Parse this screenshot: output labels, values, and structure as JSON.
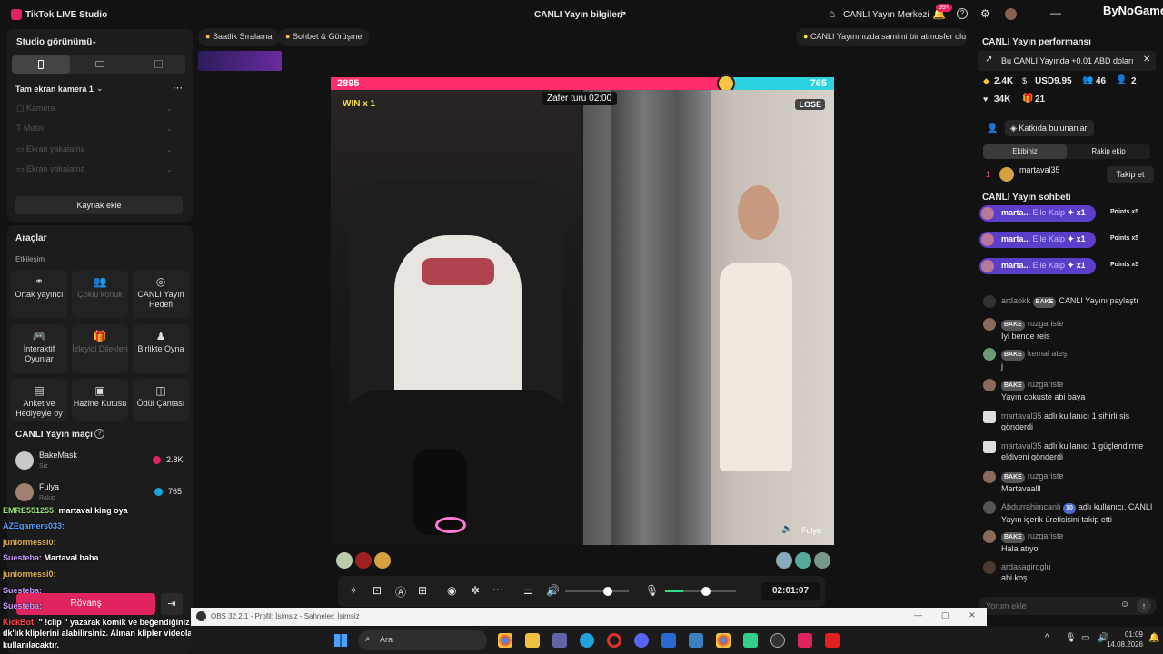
{
  "app": {
    "title": "TikTok LIVE Studio",
    "center_title": "CANLI Yayın bilgileri",
    "center_label": "CANLI Yayın Merkezi",
    "notif_count": "99+",
    "watermark": "ByNoGame"
  },
  "left": {
    "studio_view": "Studio görünümü",
    "scene_name": "Tam ekran kamera 1",
    "sources": [
      "Kamera",
      "Metin",
      "Ekran yakalama",
      "Ekran yakalama"
    ],
    "add_source": "Kaynak ekle",
    "tools_title": "Araçlar",
    "interaction_label": "Etkileşim",
    "tools": [
      {
        "label": "Ortak yayıncı",
        "icon": "link-icon"
      },
      {
        "label": "Çoklu konuk",
        "icon": "users-icon"
      },
      {
        "label": "CANLI Yayın Hedefi",
        "icon": "target-icon"
      },
      {
        "label": "İnteraktif Oyunlar",
        "icon": "gamepad-icon"
      },
      {
        "label": "İzleyici Dilekleri",
        "icon": "gift-icon"
      },
      {
        "label": "Birlikte Oyna",
        "icon": "person-icon"
      },
      {
        "label": "Anket ve Hediyeyle oy",
        "icon": "poll-icon"
      },
      {
        "label": "Hazine Kutusu",
        "icon": "chest-icon"
      },
      {
        "label": "Ödül Çantası",
        "icon": "bag-icon"
      }
    ],
    "match_title": "CANLI Yayın maçı",
    "players": [
      {
        "name": "BakeMask",
        "sub": "Siz",
        "score": "2.8K"
      },
      {
        "name": "Fulya",
        "sub": "Rakip",
        "score": "765"
      }
    ],
    "rematch": "Rövanş"
  },
  "overlay_chat": [
    {
      "user": "EMRE551255:",
      "msg": " martaval king oya",
      "color": "#9be37a"
    },
    {
      "user": "AZEgamers033:",
      "msg": "",
      "color": "#5aa0ff"
    },
    {
      "user": "juniormessi0:",
      "msg": "",
      "color": "#e0b050"
    },
    {
      "user": "Suesteba:",
      "msg": " Martaval baba",
      "color": "#c89cff"
    },
    {
      "user": "juniormessi0:",
      "msg": "",
      "color": "#e0b050"
    },
    {
      "user": "Suesteba:",
      "msg": "",
      "color": "#c89cff"
    },
    {
      "user": "Suesteba:",
      "msg": "",
      "color": "#c89cff"
    },
    {
      "user": "KickBot:",
      "msg": " \" !clip \" yazarak komik ve beğendiğiniz",
      "color": "#ff4444"
    },
    {
      "user": "",
      "msg": "dk'lık kliplerini alabilirsiniz. Alınan klipler videolarda",
      "color": "#fff"
    },
    {
      "user": "",
      "msg": "kullanılacaktır.",
      "color": "#fff"
    }
  ],
  "top_chips": {
    "ranking": "Saatlik Sıralama",
    "chat": "Sohbet & Görüşme",
    "tip": "CANLI Yayınınızda samimi bir atmosfer olu..."
  },
  "battle": {
    "left_score": "2895",
    "right_score": "765",
    "win": "WIN x 1",
    "lose": "LOSE",
    "round": "Zafer turu 02:00",
    "right_name": "Fulya"
  },
  "controls": {
    "timer": "02:01:07"
  },
  "right": {
    "perf_title": "CANLI Yayın performansı",
    "perf_banner": "Bu CANLI Yayında +0.01 ABD doları",
    "stats": [
      "2.4K",
      "USD9.95",
      "46",
      "2",
      "34K",
      "21"
    ],
    "contributors": "Katkıda bulunanlar",
    "tabs": [
      "Ekibiniz",
      "Rakip ekip"
    ],
    "top_user": {
      "rank": "1",
      "name": "martaval35",
      "follow": "Takip et"
    },
    "chat_title": "CANLI Yayın sohbeti",
    "gifts": [
      {
        "name": "marta...",
        "gift": "Elle Kalp",
        "mult": "x1",
        "points": "Points x5"
      },
      {
        "name": "marta...",
        "gift": "Elle Kalp",
        "mult": "x1",
        "points": "Points x5"
      },
      {
        "name": "marta...",
        "gift": "Elle Kalp",
        "mult": "x1",
        "points": "Points x5"
      }
    ],
    "messages": [
      {
        "user": "ardaokk",
        "badge": "BAKE",
        "text": "CANLI Yayını paylaştı",
        "inline": true
      },
      {
        "user": "ruzgariste",
        "badge": "BAKE",
        "text": "İyi bende reis"
      },
      {
        "user": "kemal ateş",
        "badge": "BAKE",
        "text": "j"
      },
      {
        "user": "ruzgariste",
        "badge": "BAKE",
        "text": "Yayın cokuste abi baya"
      },
      {
        "user": "martaval35",
        "badge": "",
        "text": "adlı kullanıcı 1 sihirli sis gönderdi",
        "system": true
      },
      {
        "user": "martaval35",
        "badge": "",
        "text": "adlı kullanıcı 1 güçlendirme eldiveni gönderdi",
        "system": true
      },
      {
        "user": "ruzgariste",
        "badge": "BAKE",
        "text": "Martavaalll"
      },
      {
        "user": "Abdurrahimcanlı",
        "badge": "10",
        "text": "adlı kullanıcı, CANLI Yayın içerik üreticisini takip etti",
        "system": true
      },
      {
        "user": "ruzgariste",
        "badge": "BAKE",
        "text": "Hala atıyo"
      },
      {
        "user": "ardasagiroglu",
        "badge": "",
        "text": "abi koş"
      }
    ],
    "comment_placeholder": "Yorum ekle"
  },
  "obs": {
    "title": "OBS 32.2.1 - Profil: İsimsiz - Sahneler: İsimsiz"
  },
  "taskbar": {
    "search": "Ara",
    "time": "01:09",
    "date": "14.08.2026"
  }
}
